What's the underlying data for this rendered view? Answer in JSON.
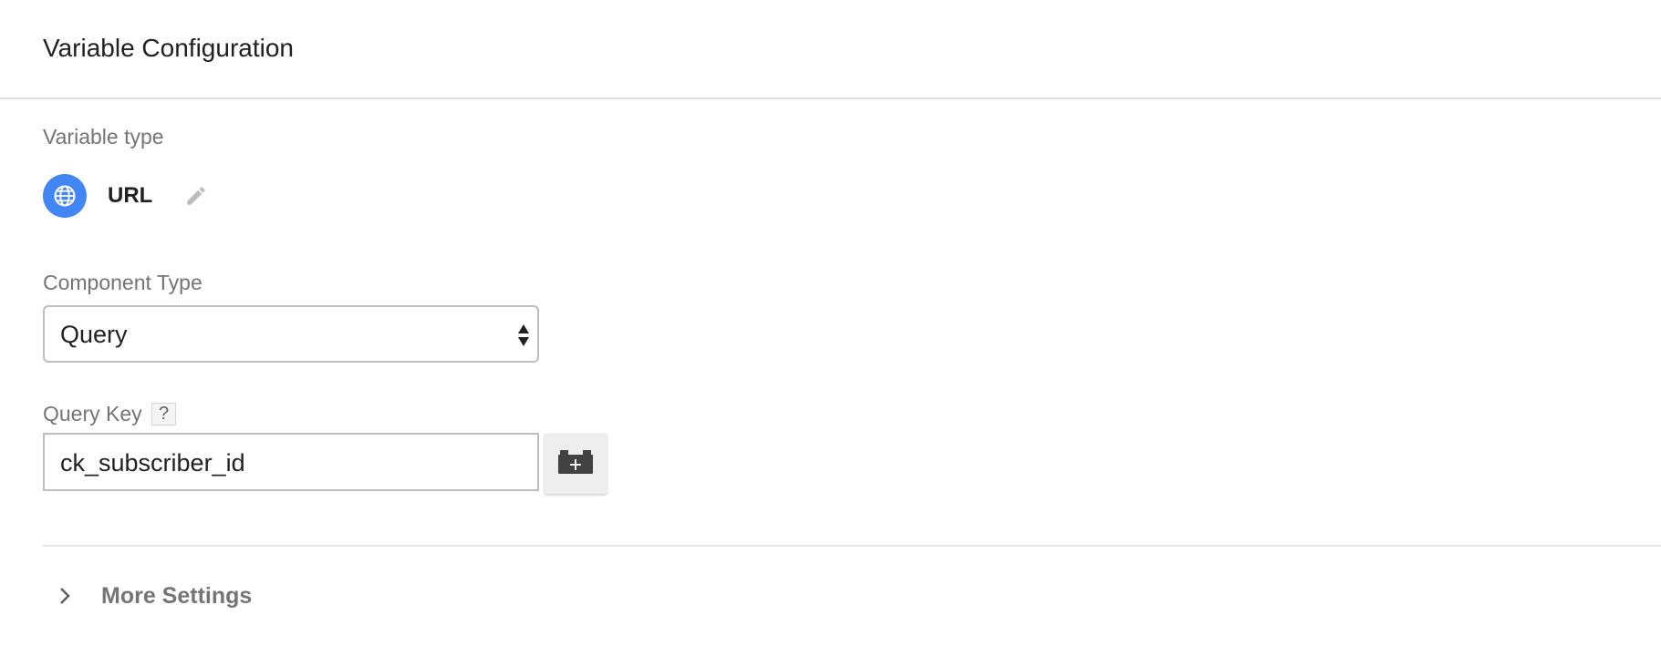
{
  "header": {
    "title": "Variable Configuration"
  },
  "variable_type": {
    "label": "Variable type",
    "icon": "globe-icon",
    "name": "URL",
    "edit_icon": "pencil-icon"
  },
  "component_type": {
    "label": "Component Type",
    "selected": "Query"
  },
  "query_key": {
    "label": "Query Key",
    "help": "?",
    "value": "ck_subscriber_id",
    "picker_icon": "add-variable-icon"
  },
  "more_settings": {
    "label": "More Settings",
    "icon": "chevron-right-icon"
  },
  "colors": {
    "accent": "#4285f4",
    "muted_text": "#757575",
    "border": "#bdbdbd"
  }
}
